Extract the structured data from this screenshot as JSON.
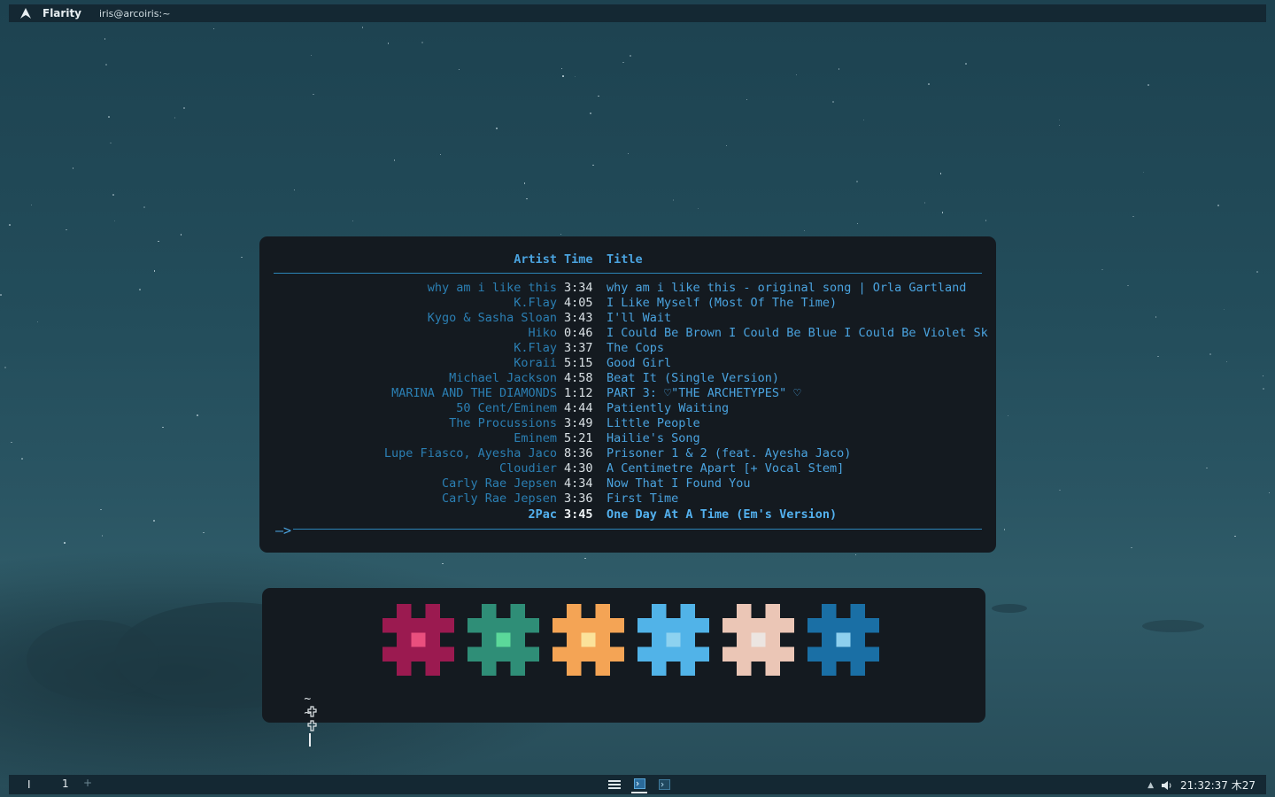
{
  "topbar": {
    "app_name": "Flarity",
    "window_title": "iris@arcoiris:~",
    "logo_icon": "arch-logo-icon"
  },
  "music_player": {
    "headers": {
      "artist": "Artist",
      "time": "Time",
      "title": "Title"
    },
    "tracks": [
      {
        "artist": "why am i like this",
        "time": "3:34",
        "title": "why am i like this - original song | Orla Gartland"
      },
      {
        "artist": "K.Flay",
        "time": "4:05",
        "title": "I Like Myself (Most Of The Time)"
      },
      {
        "artist": "Kygo & Sasha Sloan",
        "time": "3:43",
        "title": "I'll Wait"
      },
      {
        "artist": "Hiko",
        "time": "0:46",
        "title": "I Could Be Brown I Could Be Blue I Could Be Violet Sk"
      },
      {
        "artist": "K.Flay",
        "time": "3:37",
        "title": "The Cops"
      },
      {
        "artist": "Koraii",
        "time": "5:15",
        "title": "Good Girl"
      },
      {
        "artist": "Michael Jackson",
        "time": "4:58",
        "title": "Beat It (Single Version)"
      },
      {
        "artist": "MARINA AND THE DIAMONDS",
        "time": "1:12",
        "title": "PART 3: ♡\"THE ARCHETYPES\" ♡"
      },
      {
        "artist": "50 Cent/Eminem",
        "time": "4:44",
        "title": "Patiently Waiting"
      },
      {
        "artist": "The Procussions",
        "time": "3:49",
        "title": "Little People"
      },
      {
        "artist": "Eminem",
        "time": "5:21",
        "title": "Hailie's Song"
      },
      {
        "artist": "Lupe Fiasco, Ayesha Jaco",
        "time": "8:36",
        "title": "Prisoner 1 & 2 (feat. Ayesha Jaco)"
      },
      {
        "artist": "Cloudier",
        "time": "4:30",
        "title": "A Centimetre Apart [+ Vocal Stem]"
      },
      {
        "artist": "Carly Rae Jepsen",
        "time": "4:34",
        "title": "Now That I Found You"
      },
      {
        "artist": "Carly Rae Jepsen",
        "time": "3:36",
        "title": "First Time"
      },
      {
        "artist": "2Pac",
        "time": "3:45",
        "title": "One Day At A Time (Em's Version)",
        "current": true
      }
    ],
    "progress_arrow": "—>",
    "progress": 0.0
  },
  "colorscheme": {
    "glyphs": [
      {
        "name": "glyph-crimson",
        "main": "#9b1a50",
        "center": "#ea4f7e"
      },
      {
        "name": "glyph-teal",
        "main": "#2f8e77",
        "center": "#5bd89a"
      },
      {
        "name": "glyph-orange",
        "main": "#f4a455",
        "center": "#fbe29a"
      },
      {
        "name": "glyph-skyblue",
        "main": "#51b3e8",
        "center": "#8dd2f0"
      },
      {
        "name": "glyph-peach",
        "main": "#ebc6b6",
        "center": "#ece5e1"
      },
      {
        "name": "glyph-blue",
        "main": "#1a6fa5",
        "center": "#8ed0ee"
      }
    ],
    "prompt_symbol": "~",
    "prompt_icon": "cross-icon",
    "prompt_lines": 2
  },
  "bottombar": {
    "workspace_marker": "I",
    "workspace": "1",
    "add_symbol": "+",
    "clock": "21:32:37 木27",
    "tray": [
      "tray-arrow-icon",
      "volume-icon"
    ],
    "tasks": [
      "task-list-icon",
      "terminal-task-icon",
      "terminal-task-icon"
    ]
  }
}
